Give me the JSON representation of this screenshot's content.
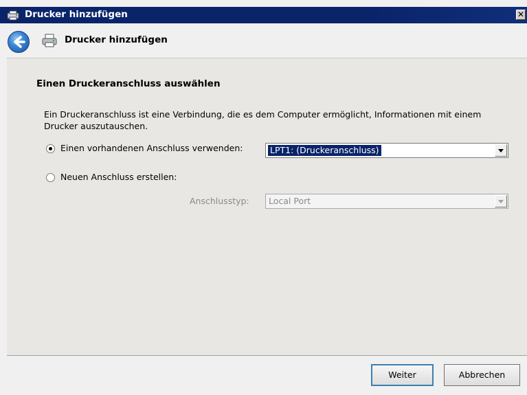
{
  "window": {
    "title": "Drucker hinzufügen",
    "close_symbol": "✕"
  },
  "header": {
    "title": "Drucker hinzufügen"
  },
  "content": {
    "heading": "Einen Druckeranschluss auswählen",
    "description": "Ein Druckeranschluss ist eine Verbindung, die es dem Computer ermöglicht, Informationen mit einem Drucker auszutauschen.",
    "option_existing": {
      "label": "Einen vorhandenen Anschluss verwenden:",
      "selected": true,
      "value": "LPT1: (Druckeranschluss)"
    },
    "option_new": {
      "label": "Neuen Anschluss erstellen:",
      "selected": false,
      "port_type_label": "Anschlusstyp:",
      "port_type_value": "Local Port"
    }
  },
  "footer": {
    "next_label": "Weiter",
    "cancel_label": "Abbrechen"
  },
  "colors": {
    "title_bar": "#0a246a",
    "selection": "#0a246a"
  }
}
